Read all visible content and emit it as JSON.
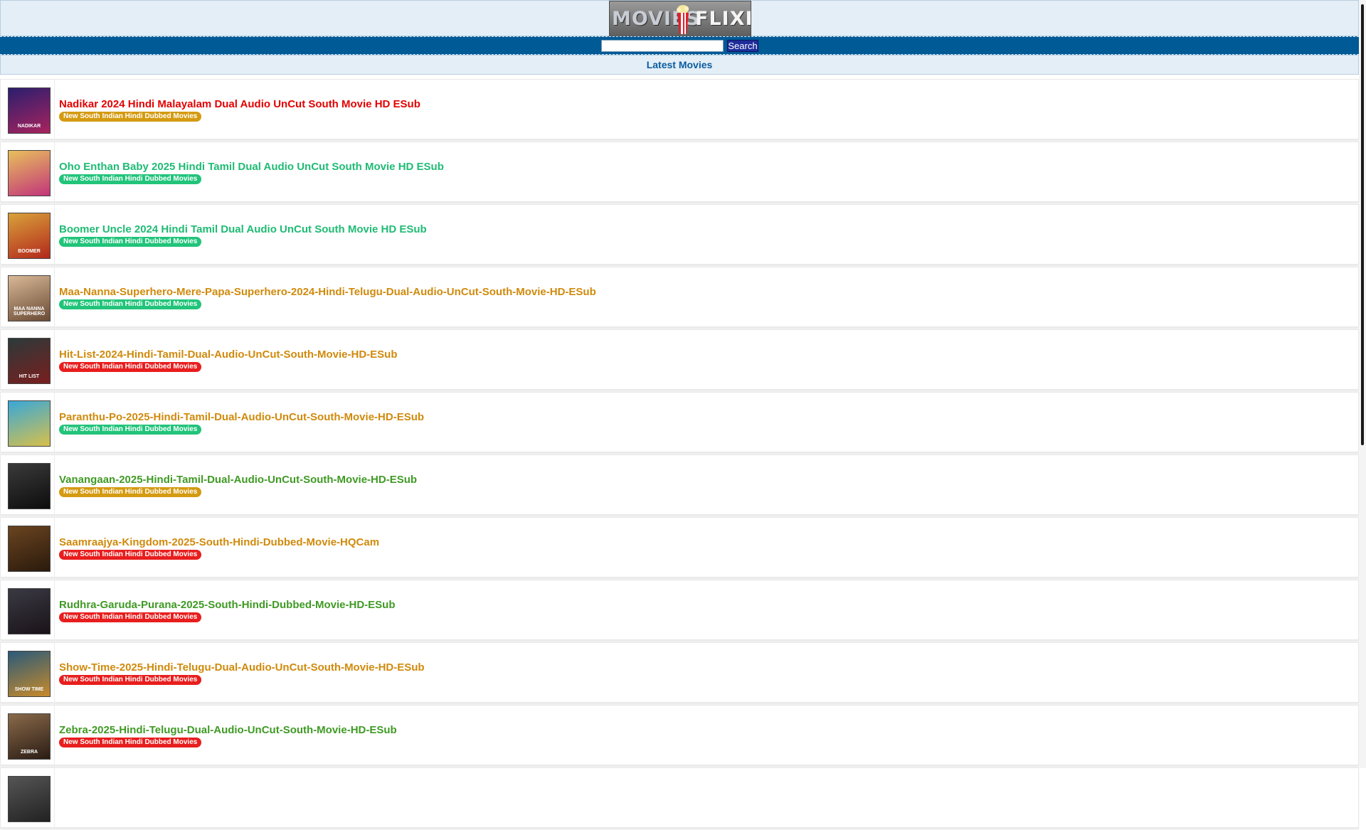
{
  "logo": {
    "part1": "MOVIES",
    "part2": "FLIXER"
  },
  "search": {
    "placeholder": "",
    "value": "",
    "button_label": "Search"
  },
  "section": {
    "title": "Latest Movies"
  },
  "colors": {
    "header_bg": "#e4eef7",
    "search_bar_bg": "#005a96",
    "section_title": "#0a5da0",
    "red": "#e30000",
    "green": "#1fbb74",
    "orange": "#d08a0c",
    "olive": "#3f9a24",
    "badge_orange": "#d49a10",
    "badge_green": "#21c47a",
    "badge_red": "#e81e1e"
  },
  "movies": [
    {
      "title": "Nadikar 2024 Hindi Malayalam Dual Audio UnCut South Movie HD ESub",
      "category": "New South Indian Hindi Dubbed Movies",
      "title_color": "#e30000",
      "badge_color": "#d49a10",
      "poster_text": "NADIKAR",
      "poster_colors": [
        "#2b1e6e",
        "#a8235e"
      ]
    },
    {
      "title": "Oho Enthan Baby 2025 Hindi Tamil Dual Audio UnCut South Movie HD ESub",
      "category": "New South Indian Hindi Dubbed Movies",
      "title_color": "#1fbb74",
      "badge_color": "#21c47a",
      "poster_text": "",
      "poster_colors": [
        "#e8c05c",
        "#c2347a"
      ]
    },
    {
      "title": "Boomer Uncle 2024 Hindi Tamil Dual Audio UnCut South Movie HD ESub",
      "category": "New South Indian Hindi Dubbed Movies",
      "title_color": "#1fbb74",
      "badge_color": "#21c47a",
      "poster_text": "BOOMER",
      "poster_colors": [
        "#d9a13a",
        "#b2281c"
      ]
    },
    {
      "title": "Maa-Nanna-Superhero-Mere-Papa-Superhero-2024-Hindi-Telugu-Dual-Audio-UnCut-South-Movie-HD-ESub",
      "category": "New South Indian Hindi Dubbed Movies",
      "title_color": "#d08a0c",
      "badge_color": "#21c47a",
      "poster_text": "MAA NANNA SUPERHERO",
      "poster_colors": [
        "#d8b896",
        "#6a4a34"
      ]
    },
    {
      "title": "Hit-List-2024-Hindi-Tamil-Dual-Audio-UnCut-South-Movie-HD-ESub",
      "category": "New South Indian Hindi Dubbed Movies",
      "title_color": "#d08a0c",
      "badge_color": "#e81e1e",
      "poster_text": "HIT LIST",
      "poster_colors": [
        "#2b3a3a",
        "#7a1e1e"
      ]
    },
    {
      "title": "Paranthu-Po-2025-Hindi-Tamil-Dual-Audio-UnCut-South-Movie-HD-ESub",
      "category": "New South Indian Hindi Dubbed Movies",
      "title_color": "#d08a0c",
      "badge_color": "#21c47a",
      "poster_text": "",
      "poster_colors": [
        "#38a8d8",
        "#d8c04a"
      ]
    },
    {
      "title": "Vanangaan-2025-Hindi-Tamil-Dual-Audio-UnCut-South-Movie-HD-ESub",
      "category": "New South Indian Hindi Dubbed Movies",
      "title_color": "#3f9a24",
      "badge_color": "#d49a10",
      "poster_text": "",
      "poster_colors": [
        "#3a3a3a",
        "#0d0d0d"
      ]
    },
    {
      "title": "Saamraajya-Kingdom-2025-South-Hindi-Dubbed-Movie-HQCam",
      "category": "New South Indian Hindi Dubbed Movies",
      "title_color": "#d08a0c",
      "badge_color": "#e81e1e",
      "poster_text": "",
      "poster_colors": [
        "#6a4420",
        "#2a1a0c"
      ]
    },
    {
      "title": "Rudhra-Garuda-Purana-2025-South-Hindi-Dubbed-Movie-HD-ESub",
      "category": "New South Indian Hindi Dubbed Movies",
      "title_color": "#3f9a24",
      "badge_color": "#e81e1e",
      "poster_text": "",
      "poster_colors": [
        "#3a3a44",
        "#1a1218"
      ]
    },
    {
      "title": "Show-Time-2025-Hindi-Telugu-Dual-Audio-UnCut-South-Movie-HD-ESub",
      "category": "New South Indian Hindi Dubbed Movies",
      "title_color": "#d08a0c",
      "badge_color": "#e81e1e",
      "poster_text": "SHOW TIME",
      "poster_colors": [
        "#2a5a7a",
        "#c88a2a"
      ]
    },
    {
      "title": "Zebra-2025-Hindi-Telugu-Dual-Audio-UnCut-South-Movie-HD-ESub",
      "category": "New South Indian Hindi Dubbed Movies",
      "title_color": "#3f9a24",
      "badge_color": "#e81e1e",
      "poster_text": "ZEBRA",
      "poster_colors": [
        "#8a6a4a",
        "#2a1c14"
      ]
    },
    {
      "title": "",
      "category": "",
      "title_color": "#3f9a24",
      "badge_color": "#e81e1e",
      "poster_text": "",
      "poster_colors": [
        "#555555",
        "#222222"
      ]
    }
  ]
}
